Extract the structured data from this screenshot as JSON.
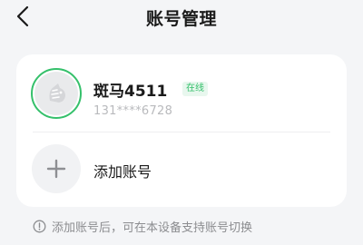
{
  "header": {
    "title": "账号管理",
    "back_icon": "chevron-left-icon"
  },
  "account": {
    "name": "斑马4511",
    "status": "在线",
    "phone": "131****6728",
    "avatar_icon": "zebra-avatar-icon",
    "accent_color": "#35c06b"
  },
  "add_account": {
    "label": "添加账号",
    "icon": "plus-icon"
  },
  "hint": {
    "icon": "info-icon",
    "text": "添加账号后，可在本设备支持账号切换"
  }
}
